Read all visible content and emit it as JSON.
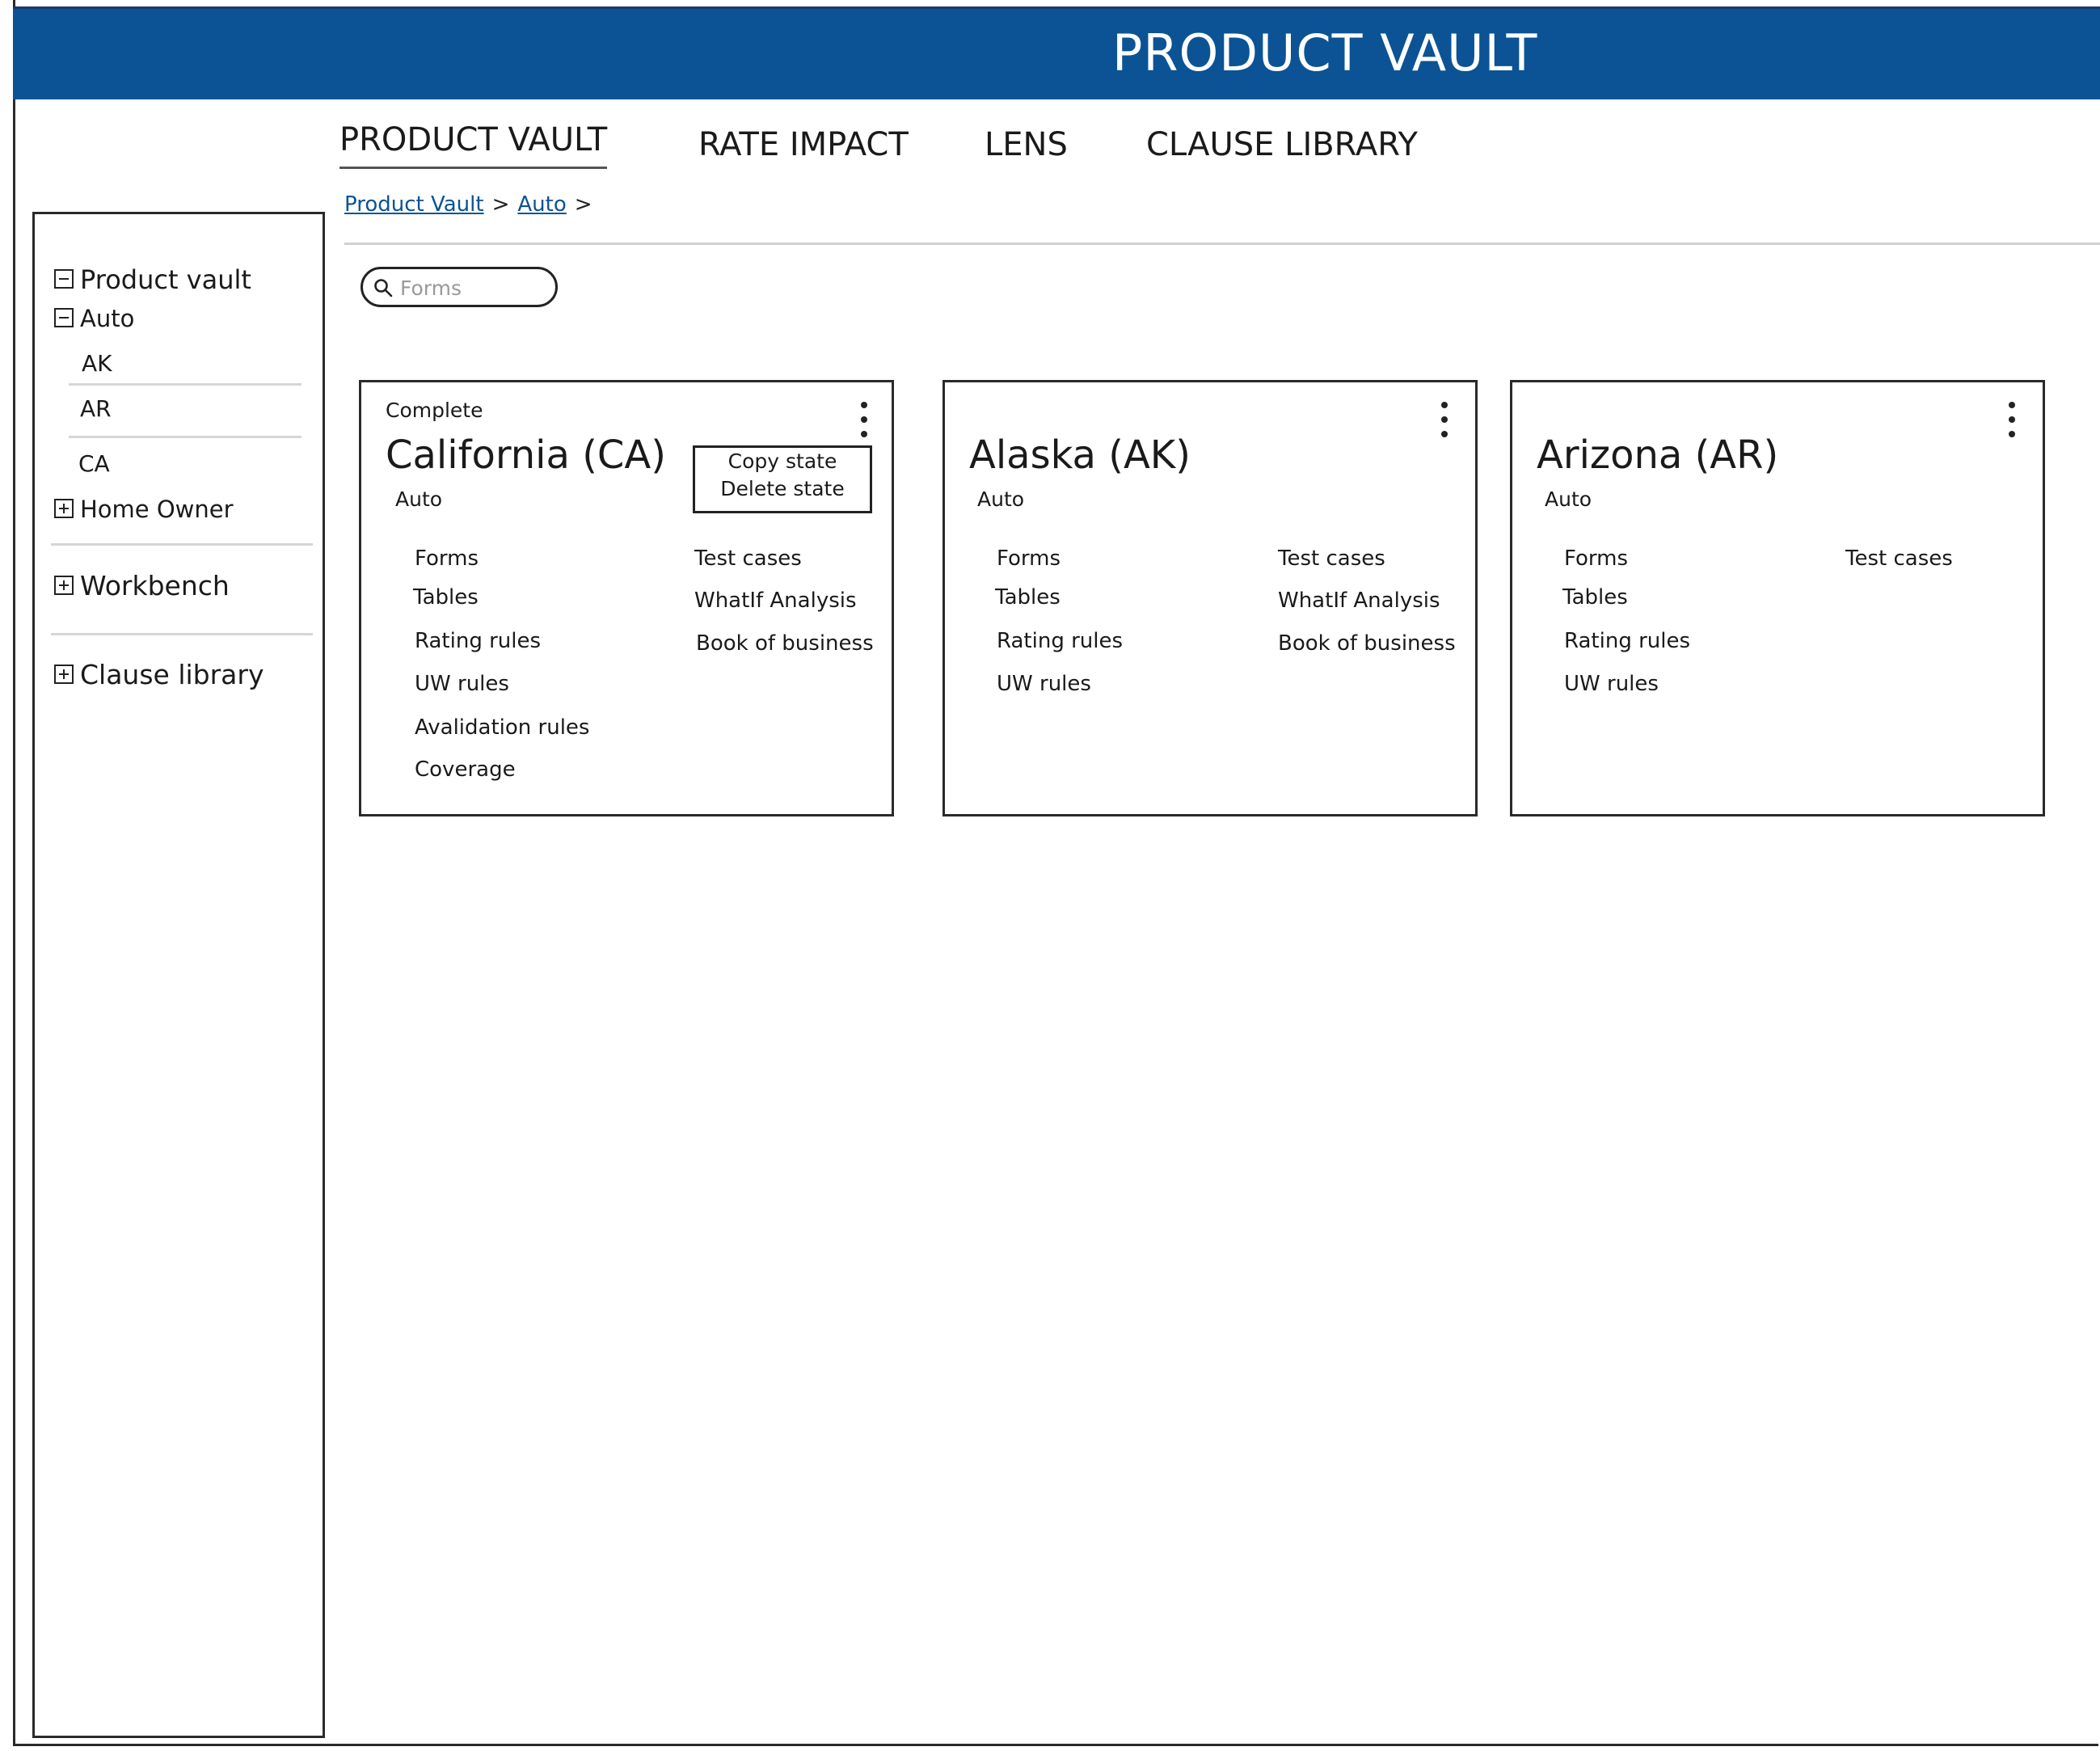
{
  "app": {
    "title": "PRODUCT VAULT"
  },
  "nav": {
    "tabs": [
      {
        "label": "PRODUCT VAULT",
        "active": true
      },
      {
        "label": "RATE IMPACT"
      },
      {
        "label": "LENS"
      },
      {
        "label": "CLAUSE LIBRARY"
      }
    ]
  },
  "breadcrumb": {
    "items": [
      "Product Vault",
      "Auto"
    ],
    "separator": ">"
  },
  "search": {
    "placeholder": "Forms",
    "value": ""
  },
  "sidebar": {
    "product_vault": "Product vault",
    "auto": "Auto",
    "states": [
      "AK",
      "AR",
      "CA"
    ],
    "home_owner": "Home Owner",
    "workbench": "Workbench",
    "clause_library": "Clause library"
  },
  "cards": [
    {
      "status": "Complete",
      "title": "California (CA)",
      "subtitle": "Auto",
      "left_links": [
        "Forms",
        "Tables",
        "Rating rules",
        "UW rules",
        "Avalidation rules",
        "Coverage"
      ],
      "right_links": [
        "Test cases",
        "WhatIf Analysis",
        "Book of business"
      ],
      "menu": [
        "Copy state",
        "Delete state"
      ]
    },
    {
      "title": "Alaska (AK)",
      "subtitle": "Auto",
      "left_links": [
        "Forms",
        "Tables",
        "Rating rules",
        "UW rules"
      ],
      "right_links": [
        "Test cases",
        "WhatIf Analysis",
        "Book of business"
      ]
    },
    {
      "title": "Arizona (AR)",
      "subtitle": "Auto",
      "left_links": [
        "Forms",
        "Tables",
        "Rating rules",
        "UW rules"
      ],
      "right_links": [
        "Test cases"
      ]
    }
  ],
  "colors": {
    "header": "#0b5394",
    "link": "#0b5394"
  }
}
